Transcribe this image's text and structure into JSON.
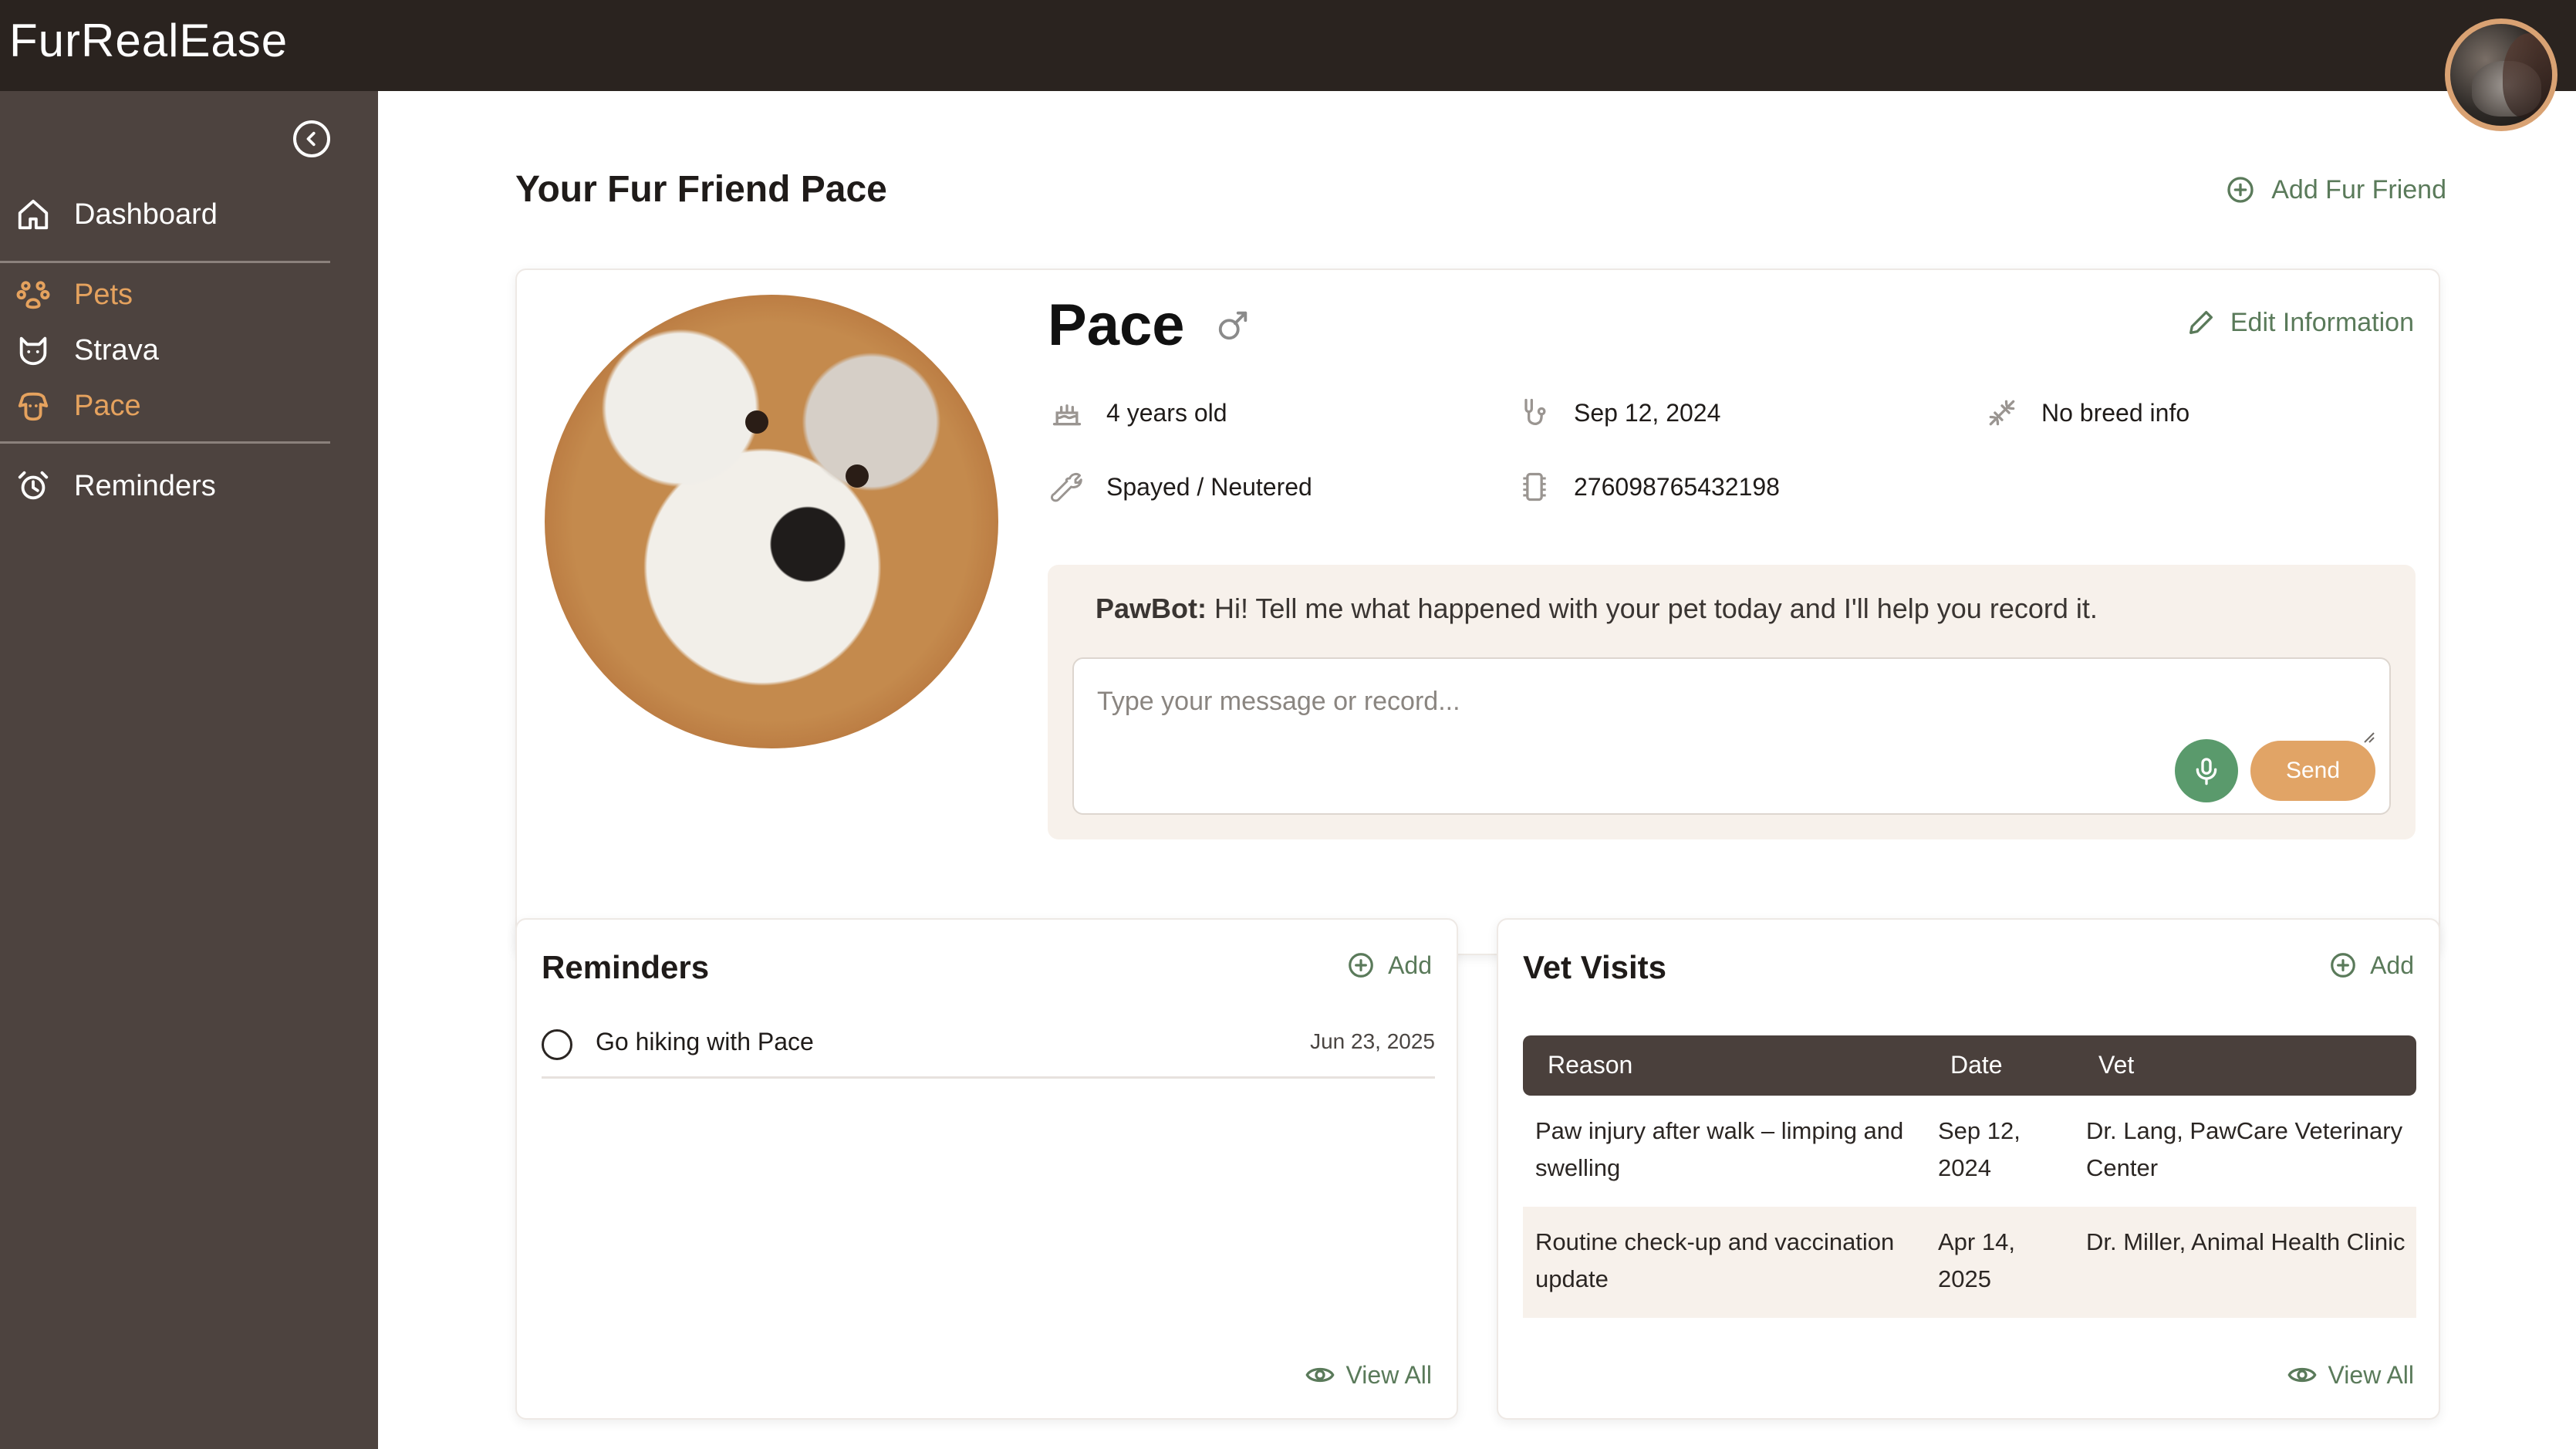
{
  "app": {
    "title": "FurRealEase"
  },
  "sidebar": {
    "items": [
      {
        "label": "Dashboard"
      },
      {
        "label": "Pets"
      },
      {
        "label": "Strava"
      },
      {
        "label": "Pace"
      },
      {
        "label": "Reminders"
      }
    ]
  },
  "main": {
    "title": "Your Fur Friend Pace",
    "add_fur_friend": "Add Fur Friend"
  },
  "pet": {
    "name": "Pace",
    "edit_label": "Edit Information",
    "facts": {
      "age": "4 years old",
      "date": "Sep 12, 2024",
      "breed": "No breed info",
      "spay": "Spayed / Neutered",
      "chip": "276098765432198"
    }
  },
  "pawbot": {
    "name": "PawBot:",
    "message": "Hi! Tell me what happened with your pet today and I'll help you record it.",
    "placeholder": "Type your message or record...",
    "send_label": "Send"
  },
  "reminders": {
    "title": "Reminders",
    "add_label": "Add",
    "view_all": "View All",
    "items": [
      {
        "text": "Go hiking with Pace",
        "date": "Jun 23, 2025"
      }
    ]
  },
  "vet_visits": {
    "title": "Vet Visits",
    "add_label": "Add",
    "view_all": "View All",
    "columns": [
      "Reason",
      "Date",
      "Vet"
    ],
    "rows": [
      {
        "reason": "Paw injury after walk – limping and swelling",
        "date": "Sep 12, 2024",
        "vet": "Dr. Lang, PawCare Veterinary Center"
      },
      {
        "reason": "Routine check-up and vaccination update",
        "date": "Apr 14, 2025",
        "vet": "Dr. Miller, Animal Health Clinic"
      }
    ]
  },
  "colors": {
    "topbar": "#2a231f",
    "sidebar": "#4d433f",
    "accent": "#e5a25e",
    "green": "#5a7a5a",
    "table_header": "#4a403c"
  },
  "icons": [
    "home-icon",
    "paw-icon",
    "cat-icon",
    "dog-icon",
    "alarm-icon",
    "chevron-left-icon",
    "plus-circle-icon",
    "male-icon",
    "pencil-icon",
    "cake-icon",
    "stethoscope-icon",
    "dna-icon",
    "wrench-icon",
    "chip-icon",
    "microphone-icon",
    "eye-icon"
  ]
}
